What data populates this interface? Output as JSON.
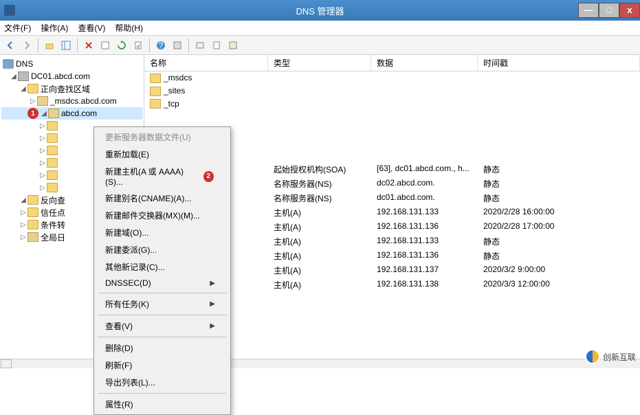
{
  "window": {
    "title": "DNS 管理器"
  },
  "menu": {
    "file": "文件(F)",
    "action": "操作(A)",
    "view": "查看(V)",
    "help": "帮助(H)"
  },
  "tree": {
    "root": "DNS",
    "server": "DC01.abcd.com",
    "fwd_zone": "正向查找区域",
    "msdcs": "_msdcs.abcd.com",
    "abcd": "abcd.com",
    "rev_zone": "反向查",
    "trust": "信任点",
    "cond": "条件转",
    "global": "全局日"
  },
  "columns": {
    "name": "名称",
    "type": "类型",
    "data": "数据",
    "time": "时间戳"
  },
  "folders": [
    "_msdcs",
    "_sites",
    "_tcp"
  ],
  "records": [
    {
      "name": "",
      "type": "起始授权机构(SOA)",
      "data": "[63], dc01.abcd.com., h...",
      "time": "静态"
    },
    {
      "name": "",
      "type": "名称服务器(NS)",
      "data": "dc02.abcd.com.",
      "time": "静态"
    },
    {
      "name": "",
      "type": "名称服务器(NS)",
      "data": "dc01.abcd.com.",
      "time": "静态"
    },
    {
      "name": "",
      "type": "主机(A)",
      "data": "192.168.131.133",
      "time": "2020/2/28 16:00:00"
    },
    {
      "name": "",
      "type": "主机(A)",
      "data": "192.168.131.136",
      "time": "2020/2/28 17:00:00"
    },
    {
      "name": "",
      "type": "主机(A)",
      "data": "192.168.131.133",
      "time": "静态"
    },
    {
      "name": "",
      "type": "主机(A)",
      "data": "192.168.131.136",
      "time": "静态"
    },
    {
      "name": "",
      "type": "主机(A)",
      "data": "192.168.131.137",
      "time": "2020/3/2 9:00:00"
    },
    {
      "name": "",
      "type": "主机(A)",
      "data": "192.168.131.138",
      "time": "2020/3/3 12:00:00"
    }
  ],
  "ctx": {
    "update": "更新服务器数据文件(U)",
    "reload": "重新加载(E)",
    "new_host": "新建主机(A 或 AAAA)(S)...",
    "new_alias": "新建别名(CNAME)(A)...",
    "new_mx": "新建邮件交换器(MX)(M)...",
    "new_domain": "新建域(O)...",
    "new_deleg": "新建委派(G)...",
    "other_rec": "其他新记录(C)...",
    "dnssec": "DNSSEC(D)",
    "all_tasks": "所有任务(K)",
    "view": "查看(V)",
    "delete": "删除(D)",
    "refresh": "刷新(F)",
    "export": "导出列表(L)...",
    "props": "属性(R)"
  },
  "badges": {
    "one": "1",
    "two": "2"
  },
  "watermark": "创新互联"
}
